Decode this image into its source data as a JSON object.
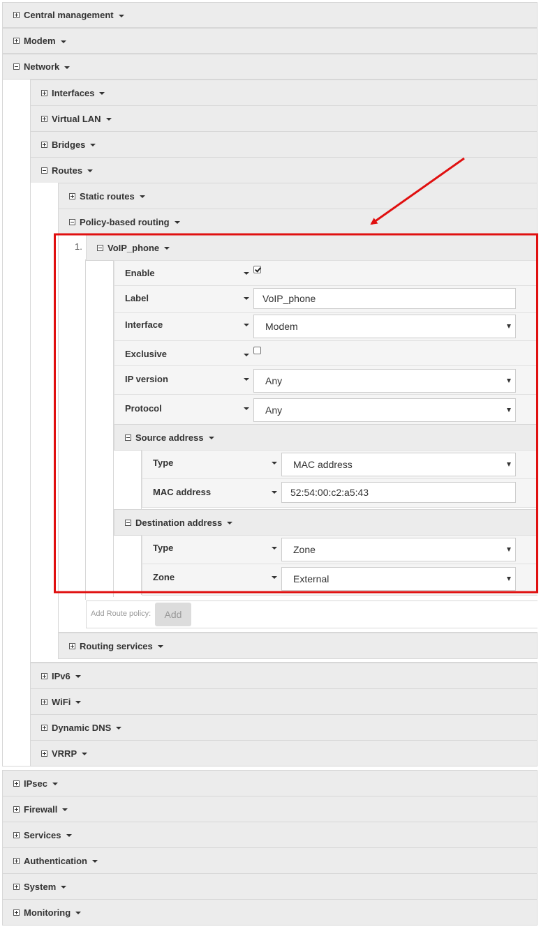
{
  "colors": {
    "header_bg": "#ececec",
    "border": "#d7d7d7",
    "row_bg": "#f5f5f5",
    "highlight": "#e01010"
  },
  "icons": {
    "collapsed": "plus-square-icon",
    "expanded": "minus-square-icon",
    "dropdown": "caret-down-icon"
  },
  "top_sections": {
    "central_management": "Central management",
    "modem": "Modem",
    "network": "Network"
  },
  "network": {
    "interfaces": "Interfaces",
    "virtual_lan": "Virtual LAN",
    "bridges": "Bridges",
    "routes": "Routes",
    "ipv6": "IPv6",
    "wifi": "WiFi",
    "dynamic_dns": "Dynamic DNS",
    "vrrp": "VRRP"
  },
  "routes": {
    "static_routes": "Static routes",
    "policy_based_routing": "Policy-based routing",
    "routing_services": "Routing services"
  },
  "policy": {
    "index": "1.",
    "name": "VoIP_phone",
    "enable": {
      "label": "Enable",
      "checked": true
    },
    "label_field": {
      "label": "Label",
      "value": "VoIP_phone"
    },
    "interface": {
      "label": "Interface",
      "value": "Modem"
    },
    "exclusive": {
      "label": "Exclusive",
      "checked": false
    },
    "ip_version": {
      "label": "IP version",
      "value": "Any"
    },
    "protocol": {
      "label": "Protocol",
      "value": "Any"
    },
    "source": {
      "title": "Source address",
      "type": {
        "label": "Type",
        "value": "MAC address"
      },
      "mac": {
        "label": "MAC address",
        "value": "52:54:00:c2:a5:43"
      }
    },
    "destination": {
      "title": "Destination address",
      "type": {
        "label": "Type",
        "value": "Zone"
      },
      "zone": {
        "label": "Zone",
        "value": "External"
      }
    },
    "add_label": "Add Route policy:",
    "add_button": "Add"
  },
  "bottom_sections": {
    "ipsec": "IPsec",
    "firewall": "Firewall",
    "services": "Services",
    "authentication": "Authentication",
    "system": "System",
    "monitoring": "Monitoring"
  }
}
